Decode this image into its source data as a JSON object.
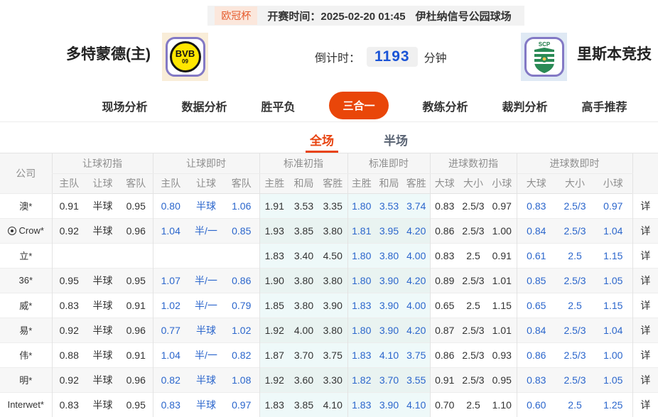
{
  "colors": {
    "accent_orange": "#e94609",
    "tab_orange": "#e8430f",
    "live_blue": "#2b66cc",
    "countdown_blue": "#1a53d6",
    "bvb_yellow": "#ffe600",
    "logo_border_purple": "#8379c5",
    "cyan_column": "#eef9f9",
    "zebra_gray": "#f7f7f7"
  },
  "top_bar": {
    "league": "欧冠杯",
    "kickoff_label": "开赛时间：",
    "kickoff_time": "2025-02-20 01:45",
    "venue": "伊杜纳信号公园球场"
  },
  "match": {
    "home_name": "多特蒙德(主)",
    "home_logo_text": "BVB",
    "home_logo_sub": "09",
    "away_name": "里斯本竞技",
    "away_logo_text": "SCP",
    "countdown_label": "倒计时：",
    "countdown_value": "1193",
    "countdown_unit": "分钟"
  },
  "nav": {
    "items": [
      {
        "label": "现场分析",
        "active": false
      },
      {
        "label": "数据分析",
        "active": false
      },
      {
        "label": "胜平负",
        "active": false
      },
      {
        "label": "三合一",
        "active": true
      },
      {
        "label": "教练分析",
        "active": false
      },
      {
        "label": "裁判分析",
        "active": false
      },
      {
        "label": "高手推荐",
        "active": false
      }
    ]
  },
  "sub_tabs": {
    "items": [
      {
        "label": "全场",
        "active": true
      },
      {
        "label": "半场",
        "active": false
      }
    ]
  },
  "table": {
    "company_header": "公司",
    "detail_label": "详",
    "groups": [
      {
        "title": "让球初指",
        "cols": [
          "主队",
          "让球",
          "客队"
        ]
      },
      {
        "title": "让球即时",
        "cols": [
          "主队",
          "让球",
          "客队"
        ]
      },
      {
        "title": "标准初指",
        "cols": [
          "主胜",
          "和局",
          "客胜"
        ]
      },
      {
        "title": "标准即时",
        "cols": [
          "主胜",
          "和局",
          "客胜"
        ]
      },
      {
        "title": "进球数初指",
        "cols": [
          "大球",
          "大小",
          "小球"
        ]
      },
      {
        "title": "进球数即时",
        "cols": [
          "大球",
          "大小",
          "小球"
        ]
      }
    ],
    "rows": [
      {
        "company": "澳*",
        "icon": false,
        "hi": [
          "0.91",
          "半球",
          "0.95"
        ],
        "hl": [
          "0.80",
          "半球",
          "1.06"
        ],
        "ei": [
          "1.91",
          "3.53",
          "3.35"
        ],
        "el": [
          "1.80",
          "3.53",
          "3.74"
        ],
        "gi": [
          "0.83",
          "2.5/3",
          "0.97"
        ],
        "gl": [
          "0.83",
          "2.5/3",
          "0.97"
        ]
      },
      {
        "company": "Crow*",
        "icon": true,
        "hi": [
          "0.92",
          "半球",
          "0.96"
        ],
        "hl": [
          "1.04",
          "半/一",
          "0.85"
        ],
        "ei": [
          "1.93",
          "3.85",
          "3.80"
        ],
        "el": [
          "1.81",
          "3.95",
          "4.20"
        ],
        "gi": [
          "0.86",
          "2.5/3",
          "1.00"
        ],
        "gl": [
          "0.84",
          "2.5/3",
          "1.04"
        ]
      },
      {
        "company": "立*",
        "icon": false,
        "hi": [
          "",
          "",
          ""
        ],
        "hl": [
          "",
          "",
          ""
        ],
        "ei": [
          "1.83",
          "3.40",
          "4.50"
        ],
        "el": [
          "1.80",
          "3.80",
          "4.00"
        ],
        "gi": [
          "0.83",
          "2.5",
          "0.91"
        ],
        "gl": [
          "0.61",
          "2.5",
          "1.15"
        ]
      },
      {
        "company": "36*",
        "icon": false,
        "hi": [
          "0.95",
          "半球",
          "0.95"
        ],
        "hl": [
          "1.07",
          "半/一",
          "0.86"
        ],
        "ei": [
          "1.90",
          "3.80",
          "3.80"
        ],
        "el": [
          "1.80",
          "3.90",
          "4.20"
        ],
        "gi": [
          "0.89",
          "2.5/3",
          "1.01"
        ],
        "gl": [
          "0.85",
          "2.5/3",
          "1.05"
        ]
      },
      {
        "company": "威*",
        "icon": false,
        "hi": [
          "0.83",
          "半球",
          "0.91"
        ],
        "hl": [
          "1.02",
          "半/一",
          "0.79"
        ],
        "ei": [
          "1.85",
          "3.80",
          "3.90"
        ],
        "el": [
          "1.83",
          "3.90",
          "4.00"
        ],
        "gi": [
          "0.65",
          "2.5",
          "1.15"
        ],
        "gl": [
          "0.65",
          "2.5",
          "1.15"
        ]
      },
      {
        "company": "易*",
        "icon": false,
        "hi": [
          "0.92",
          "半球",
          "0.96"
        ],
        "hl": [
          "0.77",
          "半球",
          "1.02"
        ],
        "ei": [
          "1.92",
          "4.00",
          "3.80"
        ],
        "el": [
          "1.80",
          "3.90",
          "4.20"
        ],
        "gi": [
          "0.87",
          "2.5/3",
          "1.01"
        ],
        "gl": [
          "0.84",
          "2.5/3",
          "1.04"
        ]
      },
      {
        "company": "伟*",
        "icon": false,
        "hi": [
          "0.88",
          "半球",
          "0.91"
        ],
        "hl": [
          "1.04",
          "半/一",
          "0.82"
        ],
        "ei": [
          "1.87",
          "3.70",
          "3.75"
        ],
        "el": [
          "1.83",
          "4.10",
          "3.75"
        ],
        "gi": [
          "0.86",
          "2.5/3",
          "0.93"
        ],
        "gl": [
          "0.86",
          "2.5/3",
          "1.00"
        ]
      },
      {
        "company": "明*",
        "icon": false,
        "hi": [
          "0.92",
          "半球",
          "0.96"
        ],
        "hl": [
          "0.82",
          "半球",
          "1.08"
        ],
        "ei": [
          "1.92",
          "3.60",
          "3.30"
        ],
        "el": [
          "1.82",
          "3.70",
          "3.55"
        ],
        "gi": [
          "0.91",
          "2.5/3",
          "0.95"
        ],
        "gl": [
          "0.83",
          "2.5/3",
          "1.05"
        ]
      },
      {
        "company": "Interwet*",
        "icon": false,
        "hi": [
          "0.83",
          "半球",
          "0.95"
        ],
        "hl": [
          "0.83",
          "半球",
          "0.97"
        ],
        "ei": [
          "1.83",
          "3.85",
          "4.10"
        ],
        "el": [
          "1.83",
          "3.90",
          "4.10"
        ],
        "gi": [
          "0.70",
          "2.5",
          "1.10"
        ],
        "gl": [
          "0.60",
          "2.5",
          "1.25"
        ]
      }
    ]
  }
}
